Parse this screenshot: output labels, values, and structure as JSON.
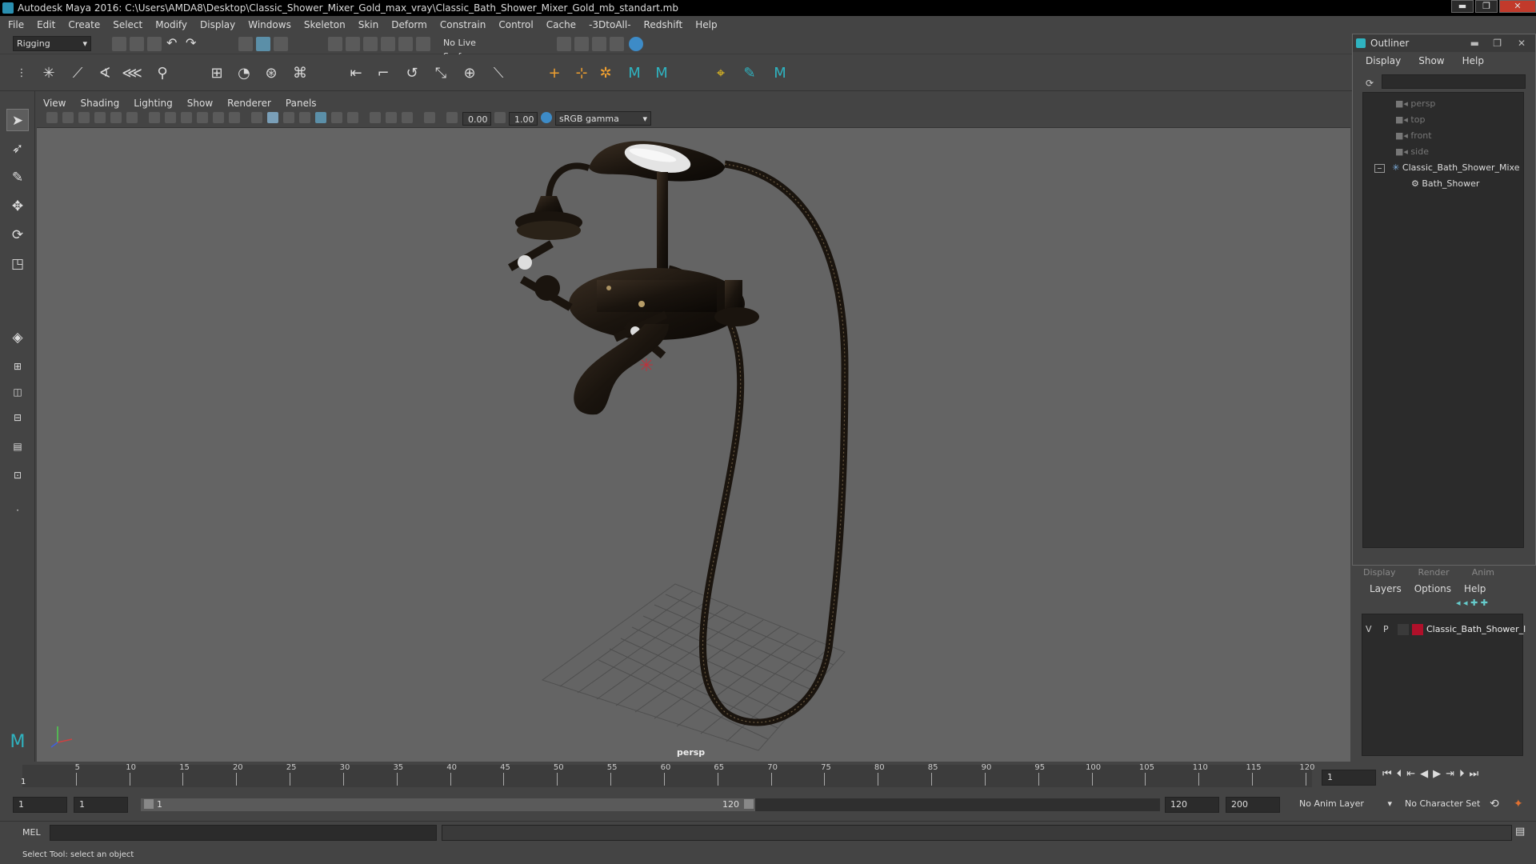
{
  "window": {
    "title": "Autodesk Maya 2016: C:\\Users\\AMDA8\\Desktop\\Classic_Shower_Mixer_Gold_max_vray\\Classic_Bath_Shower_Mixer_Gold_mb_standart.mb",
    "min": "▬",
    "max": "❐",
    "close": "✕"
  },
  "menubar": [
    "File",
    "Edit",
    "Create",
    "Select",
    "Modify",
    "Display",
    "Windows",
    "Skeleton",
    "Skin",
    "Deform",
    "Constrain",
    "Control",
    "Cache",
    "-3DtoAll-",
    "Redshift",
    "Help"
  ],
  "statusline": {
    "menuset": "Rigging",
    "live_surface": "No Live Surface"
  },
  "viewport": {
    "menu": [
      "View",
      "Shading",
      "Lighting",
      "Show",
      "Renderer",
      "Panels"
    ],
    "exposure": "0.00",
    "gamma": "1.00",
    "colorspace": "sRGB gamma",
    "camera_label": "persp"
  },
  "outliner": {
    "title": "Outliner",
    "menu": [
      "Display",
      "Show",
      "Help"
    ],
    "items": [
      {
        "label": "persp"
      },
      {
        "label": "top"
      },
      {
        "label": "front"
      },
      {
        "label": "side"
      },
      {
        "label": "Classic_Bath_Shower_Mixe"
      },
      {
        "label": "Bath_Shower"
      }
    ]
  },
  "layer_editor": {
    "tabs": [
      "Display",
      "Render",
      "Anim"
    ],
    "menu": [
      "Layers",
      "Options",
      "Help"
    ],
    "layer": {
      "v": "V",
      "p": "P",
      "name": "Classic_Bath_Shower_l",
      "color": "#b0102a"
    }
  },
  "timeline": {
    "ticks": [
      "5",
      "10",
      "15",
      "20",
      "25",
      "30",
      "35",
      "40",
      "45",
      "50",
      "55",
      "60",
      "65",
      "70",
      "75",
      "80",
      "85",
      "90",
      "95",
      "100",
      "105",
      "110",
      "115",
      "120"
    ],
    "current_marker": "1",
    "current_frame": "1"
  },
  "range": {
    "start": "1",
    "anim_start": "1",
    "slider_start": "1",
    "slider_end": "120",
    "anim_end": "120",
    "end": "200",
    "anim_layer": "No Anim Layer",
    "char_set": "No Character Set"
  },
  "cmdline": {
    "label": "MEL"
  },
  "help_line": "Select Tool: select an object"
}
